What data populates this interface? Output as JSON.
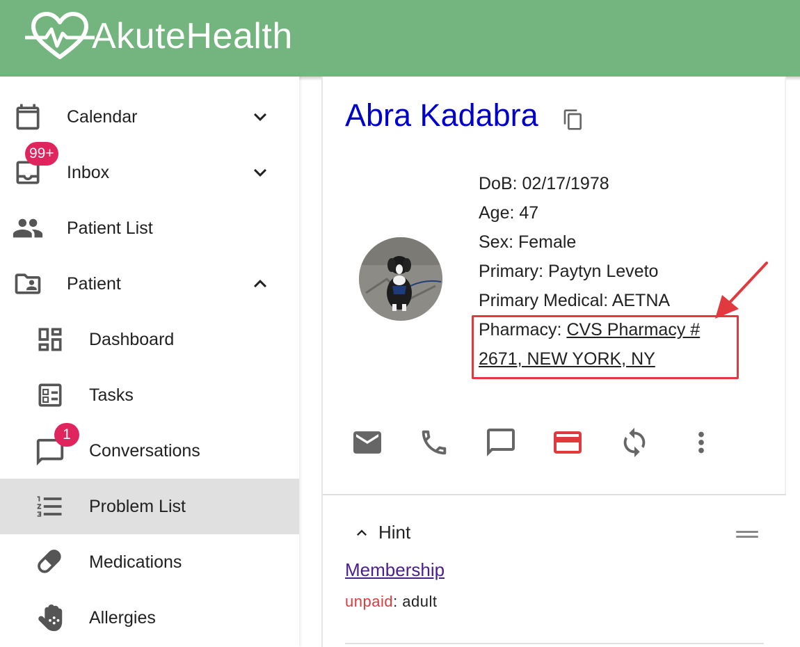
{
  "app": {
    "logo_text": "AkuteHealth",
    "header_color": "#74b47f"
  },
  "sidebar": {
    "items": [
      {
        "label": "Calendar",
        "icon": "calendar-icon",
        "expand": "chevron-down"
      },
      {
        "label": "Inbox",
        "icon": "inbox-icon",
        "expand": "chevron-down",
        "badge": "99+"
      },
      {
        "label": "Patient List",
        "icon": "people-icon"
      },
      {
        "label": "Patient",
        "icon": "folder-person-icon",
        "expand": "chevron-up"
      },
      {
        "label": "Dashboard",
        "icon": "dashboard-icon"
      },
      {
        "label": "Tasks",
        "icon": "tasks-icon"
      },
      {
        "label": "Conversations",
        "icon": "chat-icon",
        "badge": "1"
      },
      {
        "label": "Problem List",
        "icon": "numbered-list-icon",
        "active": true
      },
      {
        "label": "Medications",
        "icon": "pill-icon"
      },
      {
        "label": "Allergies",
        "icon": "hand-icon"
      }
    ]
  },
  "patient": {
    "name": "Abra Kadabra",
    "dob": "DoB: 02/17/1978",
    "age": "Age: 47",
    "sex": "Sex: Female",
    "primary": "Primary: Paytyn Leveto",
    "primary_medical": "Primary Medical: AETNA",
    "pharmacy_label": "Pharmacy: ",
    "pharmacy_line1": "CVS Pharmacy #",
    "pharmacy_line2": "2671, NEW YORK, NY"
  },
  "actions": [
    "email-icon",
    "phone-icon",
    "message-icon",
    "credit-card-icon",
    "sync-icon",
    "more-vert-icon"
  ],
  "hint": {
    "title": "Hint",
    "membership_link": "Membership",
    "status_label": "unpaid",
    "status_rest": ": adult"
  },
  "colors": {
    "accent_red": "#e03a3e",
    "link_blue": "#0000cc",
    "badge_pink": "#e0245e"
  }
}
